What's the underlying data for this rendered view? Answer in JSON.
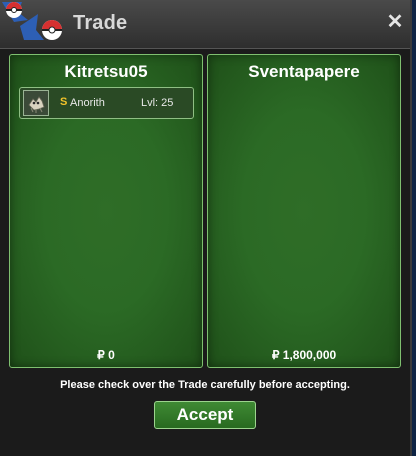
{
  "window": {
    "title": "Trade",
    "close_symbol": "✕"
  },
  "left_panel": {
    "player_name": "Kitretsu05",
    "money": "₽ 0",
    "items": [
      {
        "badge": "S",
        "name": "Anorith",
        "level": "Lvl: 25",
        "icon": "pokemon-sprite-icon"
      }
    ]
  },
  "right_panel": {
    "player_name": "Sventapapere",
    "money": "₽ 1,800,000"
  },
  "footer": {
    "notice": "Please check over the Trade carefully before accepting.",
    "accept_label": "Accept"
  },
  "colors": {
    "panel_green": "#2b6a25",
    "panel_border": "#7fc070",
    "button_green": "#3f8a34",
    "badge_gold": "#f2c32a",
    "titlebar": "#3a3a3a"
  }
}
